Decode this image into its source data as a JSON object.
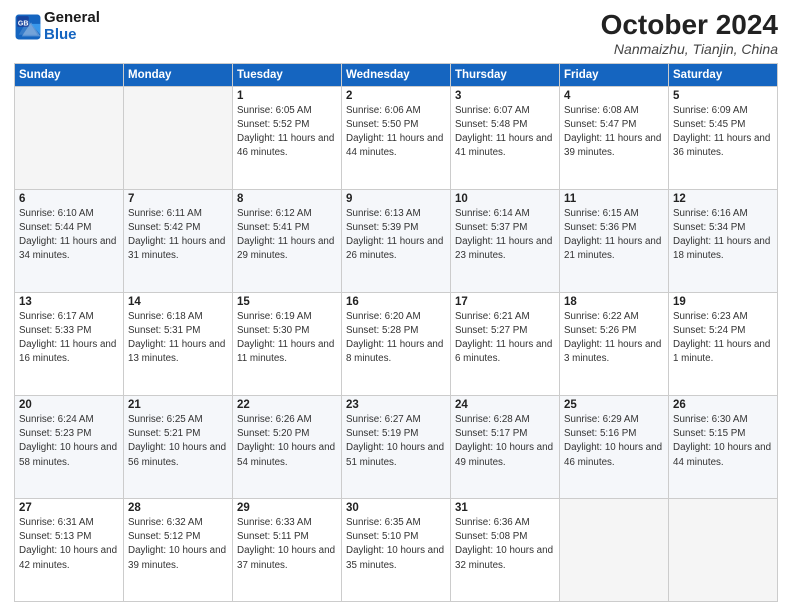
{
  "header": {
    "logo_line1": "General",
    "logo_line2": "Blue",
    "month": "October 2024",
    "location": "Nanmaizhu, Tianjin, China"
  },
  "weekdays": [
    "Sunday",
    "Monday",
    "Tuesday",
    "Wednesday",
    "Thursday",
    "Friday",
    "Saturday"
  ],
  "weeks": [
    [
      {
        "day": "",
        "info": ""
      },
      {
        "day": "",
        "info": ""
      },
      {
        "day": "1",
        "info": "Sunrise: 6:05 AM\nSunset: 5:52 PM\nDaylight: 11 hours and 46 minutes."
      },
      {
        "day": "2",
        "info": "Sunrise: 6:06 AM\nSunset: 5:50 PM\nDaylight: 11 hours and 44 minutes."
      },
      {
        "day": "3",
        "info": "Sunrise: 6:07 AM\nSunset: 5:48 PM\nDaylight: 11 hours and 41 minutes."
      },
      {
        "day": "4",
        "info": "Sunrise: 6:08 AM\nSunset: 5:47 PM\nDaylight: 11 hours and 39 minutes."
      },
      {
        "day": "5",
        "info": "Sunrise: 6:09 AM\nSunset: 5:45 PM\nDaylight: 11 hours and 36 minutes."
      }
    ],
    [
      {
        "day": "6",
        "info": "Sunrise: 6:10 AM\nSunset: 5:44 PM\nDaylight: 11 hours and 34 minutes."
      },
      {
        "day": "7",
        "info": "Sunrise: 6:11 AM\nSunset: 5:42 PM\nDaylight: 11 hours and 31 minutes."
      },
      {
        "day": "8",
        "info": "Sunrise: 6:12 AM\nSunset: 5:41 PM\nDaylight: 11 hours and 29 minutes."
      },
      {
        "day": "9",
        "info": "Sunrise: 6:13 AM\nSunset: 5:39 PM\nDaylight: 11 hours and 26 minutes."
      },
      {
        "day": "10",
        "info": "Sunrise: 6:14 AM\nSunset: 5:37 PM\nDaylight: 11 hours and 23 minutes."
      },
      {
        "day": "11",
        "info": "Sunrise: 6:15 AM\nSunset: 5:36 PM\nDaylight: 11 hours and 21 minutes."
      },
      {
        "day": "12",
        "info": "Sunrise: 6:16 AM\nSunset: 5:34 PM\nDaylight: 11 hours and 18 minutes."
      }
    ],
    [
      {
        "day": "13",
        "info": "Sunrise: 6:17 AM\nSunset: 5:33 PM\nDaylight: 11 hours and 16 minutes."
      },
      {
        "day": "14",
        "info": "Sunrise: 6:18 AM\nSunset: 5:31 PM\nDaylight: 11 hours and 13 minutes."
      },
      {
        "day": "15",
        "info": "Sunrise: 6:19 AM\nSunset: 5:30 PM\nDaylight: 11 hours and 11 minutes."
      },
      {
        "day": "16",
        "info": "Sunrise: 6:20 AM\nSunset: 5:28 PM\nDaylight: 11 hours and 8 minutes."
      },
      {
        "day": "17",
        "info": "Sunrise: 6:21 AM\nSunset: 5:27 PM\nDaylight: 11 hours and 6 minutes."
      },
      {
        "day": "18",
        "info": "Sunrise: 6:22 AM\nSunset: 5:26 PM\nDaylight: 11 hours and 3 minutes."
      },
      {
        "day": "19",
        "info": "Sunrise: 6:23 AM\nSunset: 5:24 PM\nDaylight: 11 hours and 1 minute."
      }
    ],
    [
      {
        "day": "20",
        "info": "Sunrise: 6:24 AM\nSunset: 5:23 PM\nDaylight: 10 hours and 58 minutes."
      },
      {
        "day": "21",
        "info": "Sunrise: 6:25 AM\nSunset: 5:21 PM\nDaylight: 10 hours and 56 minutes."
      },
      {
        "day": "22",
        "info": "Sunrise: 6:26 AM\nSunset: 5:20 PM\nDaylight: 10 hours and 54 minutes."
      },
      {
        "day": "23",
        "info": "Sunrise: 6:27 AM\nSunset: 5:19 PM\nDaylight: 10 hours and 51 minutes."
      },
      {
        "day": "24",
        "info": "Sunrise: 6:28 AM\nSunset: 5:17 PM\nDaylight: 10 hours and 49 minutes."
      },
      {
        "day": "25",
        "info": "Sunrise: 6:29 AM\nSunset: 5:16 PM\nDaylight: 10 hours and 46 minutes."
      },
      {
        "day": "26",
        "info": "Sunrise: 6:30 AM\nSunset: 5:15 PM\nDaylight: 10 hours and 44 minutes."
      }
    ],
    [
      {
        "day": "27",
        "info": "Sunrise: 6:31 AM\nSunset: 5:13 PM\nDaylight: 10 hours and 42 minutes."
      },
      {
        "day": "28",
        "info": "Sunrise: 6:32 AM\nSunset: 5:12 PM\nDaylight: 10 hours and 39 minutes."
      },
      {
        "day": "29",
        "info": "Sunrise: 6:33 AM\nSunset: 5:11 PM\nDaylight: 10 hours and 37 minutes."
      },
      {
        "day": "30",
        "info": "Sunrise: 6:35 AM\nSunset: 5:10 PM\nDaylight: 10 hours and 35 minutes."
      },
      {
        "day": "31",
        "info": "Sunrise: 6:36 AM\nSunset: 5:08 PM\nDaylight: 10 hours and 32 minutes."
      },
      {
        "day": "",
        "info": ""
      },
      {
        "day": "",
        "info": ""
      }
    ]
  ]
}
